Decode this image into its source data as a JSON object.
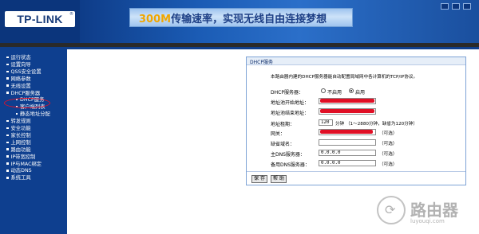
{
  "header": {
    "logo_text": "TP-LINK",
    "logo_reg": "®",
    "slogan_accent": "300M",
    "slogan_rest": "传输速率，实现无线自由连接梦想"
  },
  "sidebar": {
    "items": [
      {
        "label": "运行状态",
        "type": "main"
      },
      {
        "label": "设置向导",
        "type": "main"
      },
      {
        "label": "QSS安全设置",
        "type": "main"
      },
      {
        "label": "网络参数",
        "type": "main"
      },
      {
        "label": "无线设置",
        "type": "main"
      },
      {
        "label": "DHCP服务器",
        "type": "main",
        "active": true
      },
      {
        "label": "DHCP服务",
        "type": "sub"
      },
      {
        "label": "客户端列表",
        "type": "sub"
      },
      {
        "label": "静态地址分配",
        "type": "sub"
      },
      {
        "label": "转发规则",
        "type": "main"
      },
      {
        "label": "安全功能",
        "type": "main"
      },
      {
        "label": "家长控制",
        "type": "main"
      },
      {
        "label": "上网控制",
        "type": "main"
      },
      {
        "label": "路由功能",
        "type": "main"
      },
      {
        "label": "IP带宽控制",
        "type": "main"
      },
      {
        "label": "IP与MAC绑定",
        "type": "main"
      },
      {
        "label": "动态DNS",
        "type": "main"
      },
      {
        "label": "系统工具",
        "type": "main"
      }
    ]
  },
  "content": {
    "title": "DHCP服务",
    "description": "本路由器内建的DHCP服务器能自动配置局域网中各计算机的TCP/IP协议。",
    "dhcp_server": {
      "label": "DHCP服务器：",
      "option_off": "不启用",
      "option_on": "启用",
      "selected": "启用"
    },
    "start_addr": {
      "label": "地址池开始地址："
    },
    "end_addr": {
      "label": "地址池结束地址："
    },
    "lease": {
      "label": "地址租期：",
      "value": "120",
      "note": "分钟 （1～2880分钟，缺省为120分钟）"
    },
    "gateway": {
      "label": "网关：",
      "note": "（可选）"
    },
    "domain": {
      "label": "缺省域名：",
      "value": "",
      "note": "（可选）"
    },
    "dns_primary": {
      "label": "主DNS服务器：",
      "value": "0.0.0.0",
      "note": "（可选）"
    },
    "dns_secondary": {
      "label": "备用DNS服务器：",
      "value": "0.0.0.0",
      "note": "（可选）"
    },
    "buttons": {
      "save": "保 存",
      "help": "帮 助"
    }
  },
  "watermark": {
    "text": "路由器",
    "url": "luyouqi.com"
  },
  "colors": {
    "header_bg": "#0f3f8c",
    "sidebar_bg": "#0e3f8f",
    "slogan_accent": "#f0a600",
    "highlight_circle": "#e0102a",
    "redaction": "#e00f25"
  }
}
